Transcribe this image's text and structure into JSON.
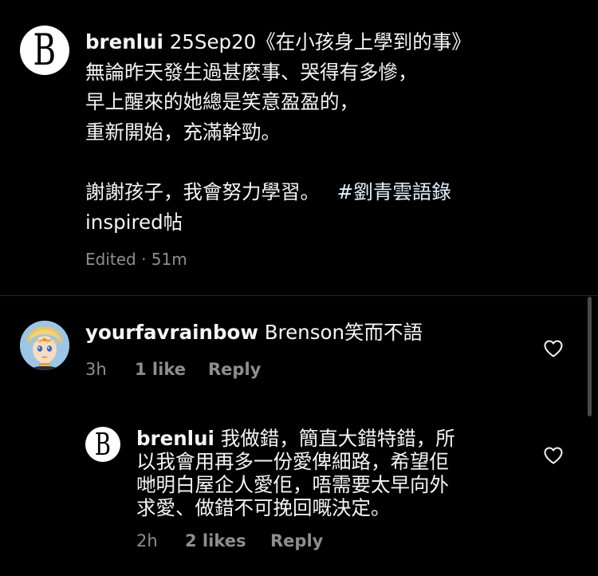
{
  "caption": {
    "username": "brenlui",
    "lines": [
      "25Sep20《在小孩身上學到的事》",
      "無論昨天發生過甚麼事、哭得有多慘，",
      "早上醒來的她總是笑意盈盈的，",
      "重新開始，充滿幹勁。",
      "謝謝孩子，我會努力學習。",
      "inspired帖"
    ],
    "hashtag": "#劉青雲語錄",
    "meta": "Edited · 51m",
    "logo_letter": "B"
  },
  "comments": [
    {
      "username": "yourfavrainbow",
      "text": "Brenson笑而不語",
      "time": "3h",
      "likes": "1 like",
      "reply_label": "Reply"
    },
    {
      "username": "brenlui",
      "text_lines": [
        "我做錯，簡直大錯特錯，所",
        "以我會用再多一份愛俾細路，希望佢",
        "哋明白屋企人愛佢，唔需要太早向外",
        "求愛、做錯不可挽回嘅決定。"
      ],
      "time": "2h",
      "likes": "2 likes",
      "reply_label": "Reply",
      "logo_letter": "B"
    }
  ],
  "icons": {
    "like": "heart-icon",
    "logo": "brand-logo-icon",
    "avatar": "cartoon-avatar-icon"
  },
  "colors": {
    "background": "#000000",
    "text": "#f5f5f5",
    "secondary": "#8e8e8e",
    "divider": "#262626",
    "hashtag": "#e0f1ff"
  }
}
